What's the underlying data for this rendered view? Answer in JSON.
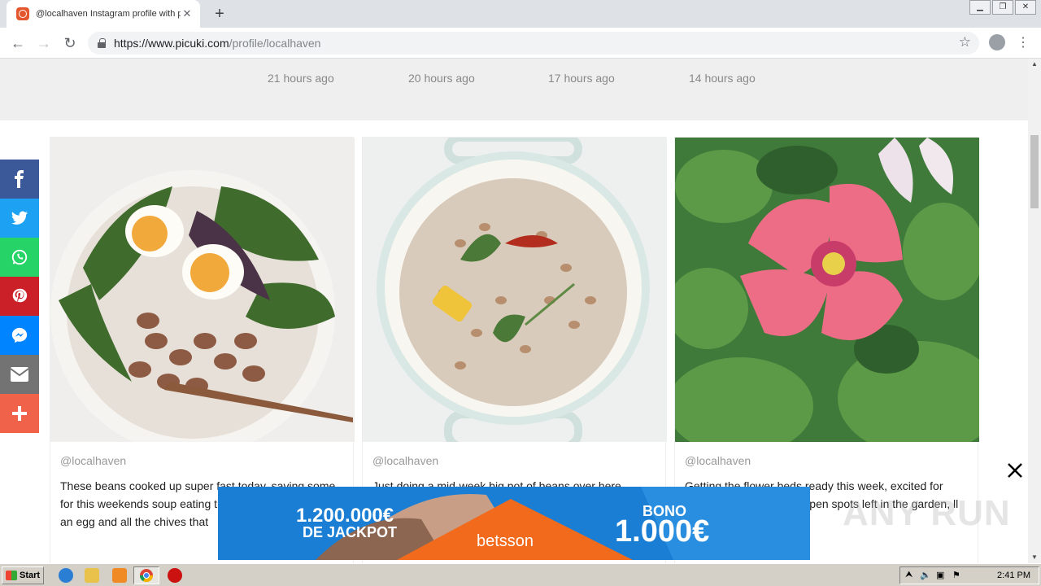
{
  "browser": {
    "tab_title": "@localhaven Instagram profile with posts",
    "tab_close": "✕",
    "new_tab": "+",
    "url_host": "https://www.picuki.com",
    "url_path": "/profile/localhaven"
  },
  "timestamps": [
    "21 hours ago",
    "20 hours ago",
    "17 hours ago",
    "14 hours ago"
  ],
  "posts": [
    {
      "user": "@localhaven",
      "text": "These beans cooked up super fast today, saving some for this weekends soup eating them a little creamy with an egg and all the chives that",
      "image": "bowl of beans with eggs and greens"
    },
    {
      "user": "@localhaven",
      "text": "Just doing a mid-week big pot of beans over here",
      "image": "pot of beans with bay leaves and herbs"
    },
    {
      "user": "@localhaven",
      "text": "Getting the flower beds ready this week, excited for come, especially these open spots left in the garden, ll me your favorites.",
      "image": "pink poppy flower in garden"
    }
  ],
  "share": [
    "facebook-icon",
    "twitter-icon",
    "whatsapp-icon",
    "pinterest-icon",
    "messenger-icon",
    "email-icon",
    "more-icon"
  ],
  "share_colors": [
    "#3b5998",
    "#1da1f2",
    "#25d366",
    "#cb2027",
    "#0084ff",
    "#737373",
    "#f0634a"
  ],
  "ad": {
    "left_top": "1.200.000€",
    "left_bottom": "DE JACKPOT",
    "brand": "betsson",
    "right_top": "BONO",
    "right_bottom": "1.000€"
  },
  "watermark": "ANY RUN",
  "taskbar": {
    "start": "Start",
    "clock": "2:41 PM"
  }
}
